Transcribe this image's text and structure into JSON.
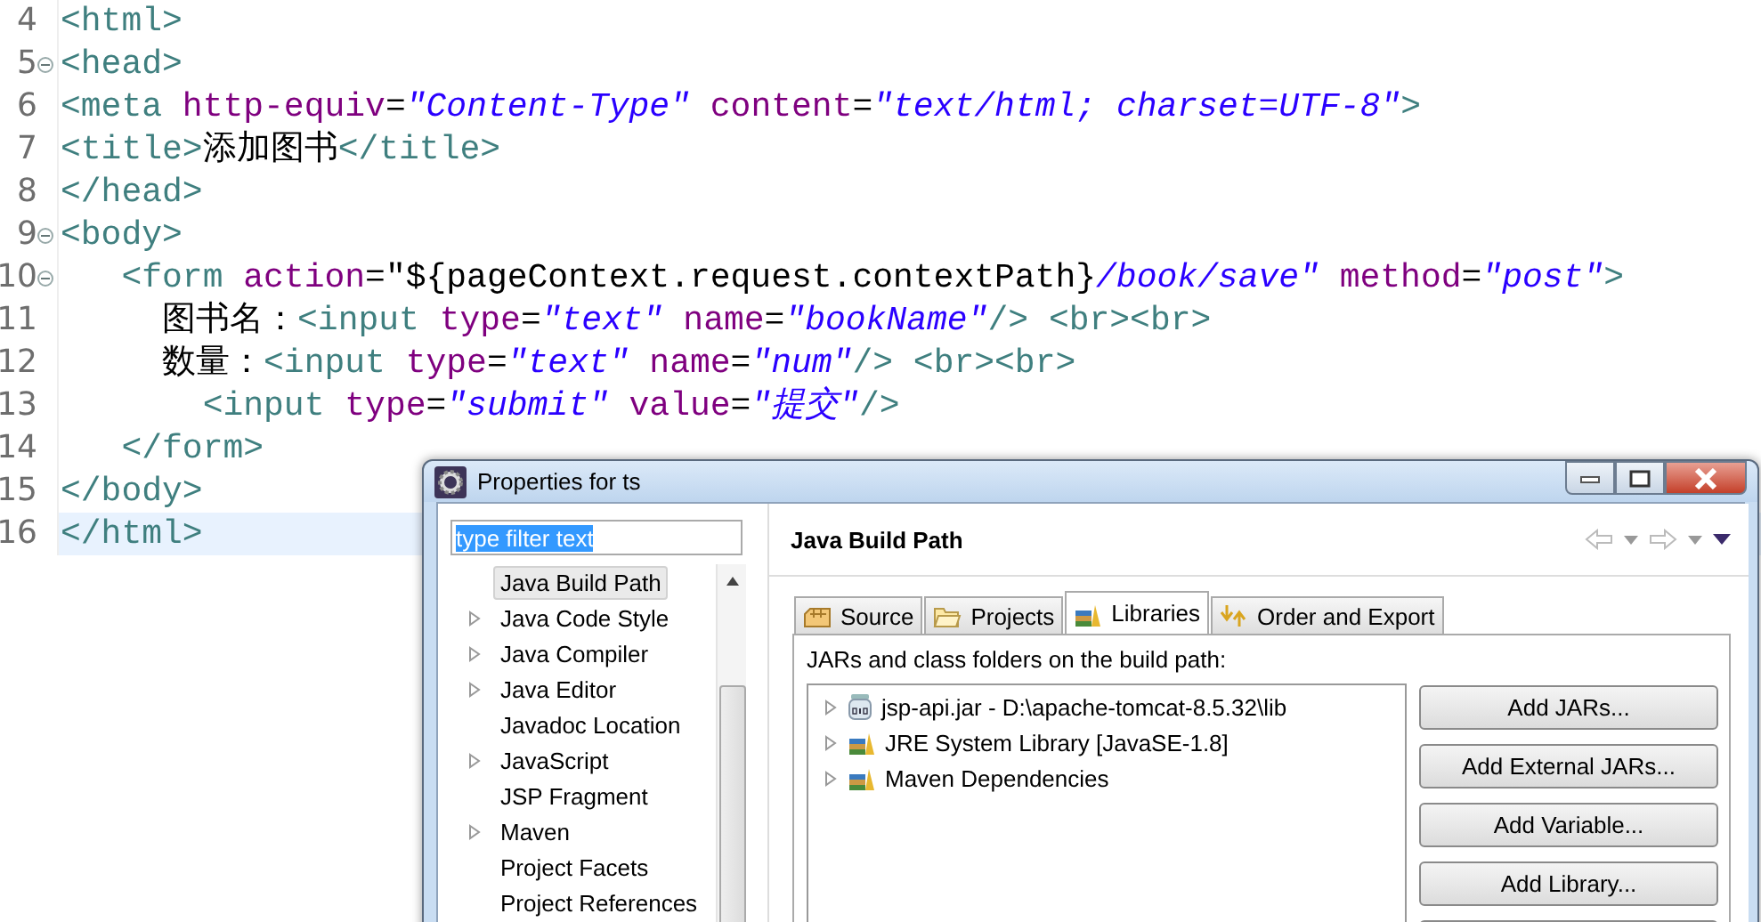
{
  "editor": {
    "lines": [
      {
        "number": "4",
        "fold": false,
        "current": false,
        "tokens": [
          {
            "kind": "tag",
            "text": "<html>"
          }
        ]
      },
      {
        "number": "5",
        "fold": true,
        "current": false,
        "tokens": [
          {
            "kind": "tag",
            "text": "<head>"
          }
        ]
      },
      {
        "number": "6",
        "fold": false,
        "current": false,
        "tokens": [
          {
            "kind": "tag",
            "text": "<meta "
          },
          {
            "kind": "attr",
            "text": "http-equiv"
          },
          {
            "kind": "plain",
            "text": "="
          },
          {
            "kind": "string",
            "text": "\"Content-Type\""
          },
          {
            "kind": "attr",
            "text": " content"
          },
          {
            "kind": "plain",
            "text": "="
          },
          {
            "kind": "string",
            "text": "\"text/html; charset=UTF-8\""
          },
          {
            "kind": "tag",
            "text": ">"
          }
        ]
      },
      {
        "number": "7",
        "fold": false,
        "current": false,
        "tokens": [
          {
            "kind": "tag",
            "text": "<title>"
          },
          {
            "kind": "plain",
            "text": "添加图书"
          },
          {
            "kind": "tag",
            "text": "</title>"
          }
        ]
      },
      {
        "number": "8",
        "fold": false,
        "current": false,
        "tokens": [
          {
            "kind": "tag",
            "text": "</head>"
          }
        ]
      },
      {
        "number": "9",
        "fold": true,
        "current": false,
        "tokens": [
          {
            "kind": "tag",
            "text": "<body>"
          }
        ]
      },
      {
        "number": "10",
        "fold": true,
        "current": false,
        "tokens": [
          {
            "kind": "tag",
            "text": "   <form "
          },
          {
            "kind": "attr",
            "text": "action"
          },
          {
            "kind": "plain",
            "text": "=\"${pageContext.request.contextPath}"
          },
          {
            "kind": "string",
            "text": "/book/save\""
          },
          {
            "kind": "attr",
            "text": " method"
          },
          {
            "kind": "plain",
            "text": "="
          },
          {
            "kind": "string",
            "text": "\"post\""
          },
          {
            "kind": "tag",
            "text": ">"
          }
        ]
      },
      {
        "number": "11",
        "fold": false,
        "current": false,
        "tokens": [
          {
            "kind": "plain",
            "text": "     图书名："
          },
          {
            "kind": "tag",
            "text": "<input "
          },
          {
            "kind": "attr",
            "text": "type"
          },
          {
            "kind": "plain",
            "text": "="
          },
          {
            "kind": "string",
            "text": "\"text\""
          },
          {
            "kind": "attr",
            "text": " name"
          },
          {
            "kind": "plain",
            "text": "="
          },
          {
            "kind": "string",
            "text": "\"bookName\""
          },
          {
            "kind": "tag",
            "text": "/> <br><br>"
          }
        ]
      },
      {
        "number": "12",
        "fold": false,
        "current": false,
        "tokens": [
          {
            "kind": "plain",
            "text": "     数量："
          },
          {
            "kind": "tag",
            "text": "<input "
          },
          {
            "kind": "attr",
            "text": "type"
          },
          {
            "kind": "plain",
            "text": "="
          },
          {
            "kind": "string",
            "text": "\"text\""
          },
          {
            "kind": "attr",
            "text": " name"
          },
          {
            "kind": "plain",
            "text": "="
          },
          {
            "kind": "string",
            "text": "\"num\""
          },
          {
            "kind": "tag",
            "text": "/> <br><br>"
          }
        ]
      },
      {
        "number": "13",
        "fold": false,
        "current": false,
        "tokens": [
          {
            "kind": "tag",
            "text": "       <input "
          },
          {
            "kind": "attr",
            "text": "type"
          },
          {
            "kind": "plain",
            "text": "="
          },
          {
            "kind": "string",
            "text": "\"submit\""
          },
          {
            "kind": "attr",
            "text": " value"
          },
          {
            "kind": "plain",
            "text": "="
          },
          {
            "kind": "string",
            "text": "\"提交\""
          },
          {
            "kind": "tag",
            "text": "/>"
          }
        ]
      },
      {
        "number": "14",
        "fold": false,
        "current": false,
        "tokens": [
          {
            "kind": "tag",
            "text": "   </form>"
          }
        ]
      },
      {
        "number": "15",
        "fold": false,
        "current": false,
        "tokens": [
          {
            "kind": "tag",
            "text": "</body>"
          }
        ]
      },
      {
        "number": "16",
        "fold": false,
        "current": true,
        "tokens": [
          {
            "kind": "tag",
            "text": "</html>"
          }
        ]
      }
    ]
  },
  "dialog": {
    "title": "Properties for ts",
    "filter": {
      "value": "type filter text"
    },
    "tree": [
      {
        "label": "Java Build Path",
        "selected": true,
        "kind": "leaf"
      },
      {
        "label": "Java Code Style",
        "selected": false,
        "kind": "branch"
      },
      {
        "label": "Java Compiler",
        "selected": false,
        "kind": "branch"
      },
      {
        "label": "Java Editor",
        "selected": false,
        "kind": "branch"
      },
      {
        "label": "Javadoc Location",
        "selected": false,
        "kind": "leaf"
      },
      {
        "label": "JavaScript",
        "selected": false,
        "kind": "branch"
      },
      {
        "label": "JSP Fragment",
        "selected": false,
        "kind": "leaf"
      },
      {
        "label": "Maven",
        "selected": false,
        "kind": "branch"
      },
      {
        "label": "Project Facets",
        "selected": false,
        "kind": "leaf"
      },
      {
        "label": "Project References",
        "selected": false,
        "kind": "leaf"
      }
    ],
    "page_title": "Java Build Path",
    "tabs": [
      {
        "label": "Source",
        "selected": false,
        "kind": "source"
      },
      {
        "label": "Projects",
        "selected": false,
        "kind": "projects"
      },
      {
        "label": "Libraries",
        "selected": true,
        "kind": "libraries"
      },
      {
        "label": "Order and Export",
        "selected": false,
        "kind": "order"
      }
    ],
    "list_caption": "JARs and class folders on the build path:",
    "entries": [
      {
        "label": "jsp-api.jar - D:\\apache-tomcat-8.5.32\\lib",
        "kind": "jar",
        "expanded": false
      },
      {
        "label": "JRE System Library [JavaSE-1.8]",
        "kind": "library",
        "expanded": false
      },
      {
        "label": "Maven Dependencies",
        "kind": "library",
        "expanded": false
      }
    ],
    "buttons": [
      "Add JARs...",
      "Add External JARs...",
      "Add Variable...",
      "Add Library..."
    ]
  }
}
